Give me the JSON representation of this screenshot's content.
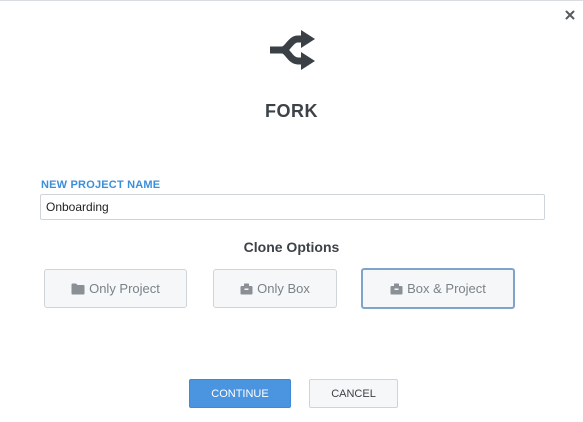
{
  "dialog": {
    "title": "FORK",
    "logo_icon": "fork-icon",
    "close_icon": "close-icon"
  },
  "form": {
    "project_name_label": "NEW PROJECT NAME",
    "project_name_value": "Onboarding"
  },
  "clone_options": {
    "heading": "Clone Options",
    "selected": "Box & Project",
    "items": [
      {
        "label": "Only Project",
        "icon": "folder-icon"
      },
      {
        "label": "Only Box",
        "icon": "box-icon"
      },
      {
        "label": "Box & Project",
        "icon": "box-icon"
      }
    ]
  },
  "actions": {
    "continue_label": "CONTINUE",
    "cancel_label": "CANCEL"
  },
  "colors": {
    "accent": "#4a94e0",
    "label_blue": "#3b8fd9",
    "selected_border": "#7ea3cc",
    "text_dark": "#3c4248",
    "text_muted": "#7b8289"
  }
}
